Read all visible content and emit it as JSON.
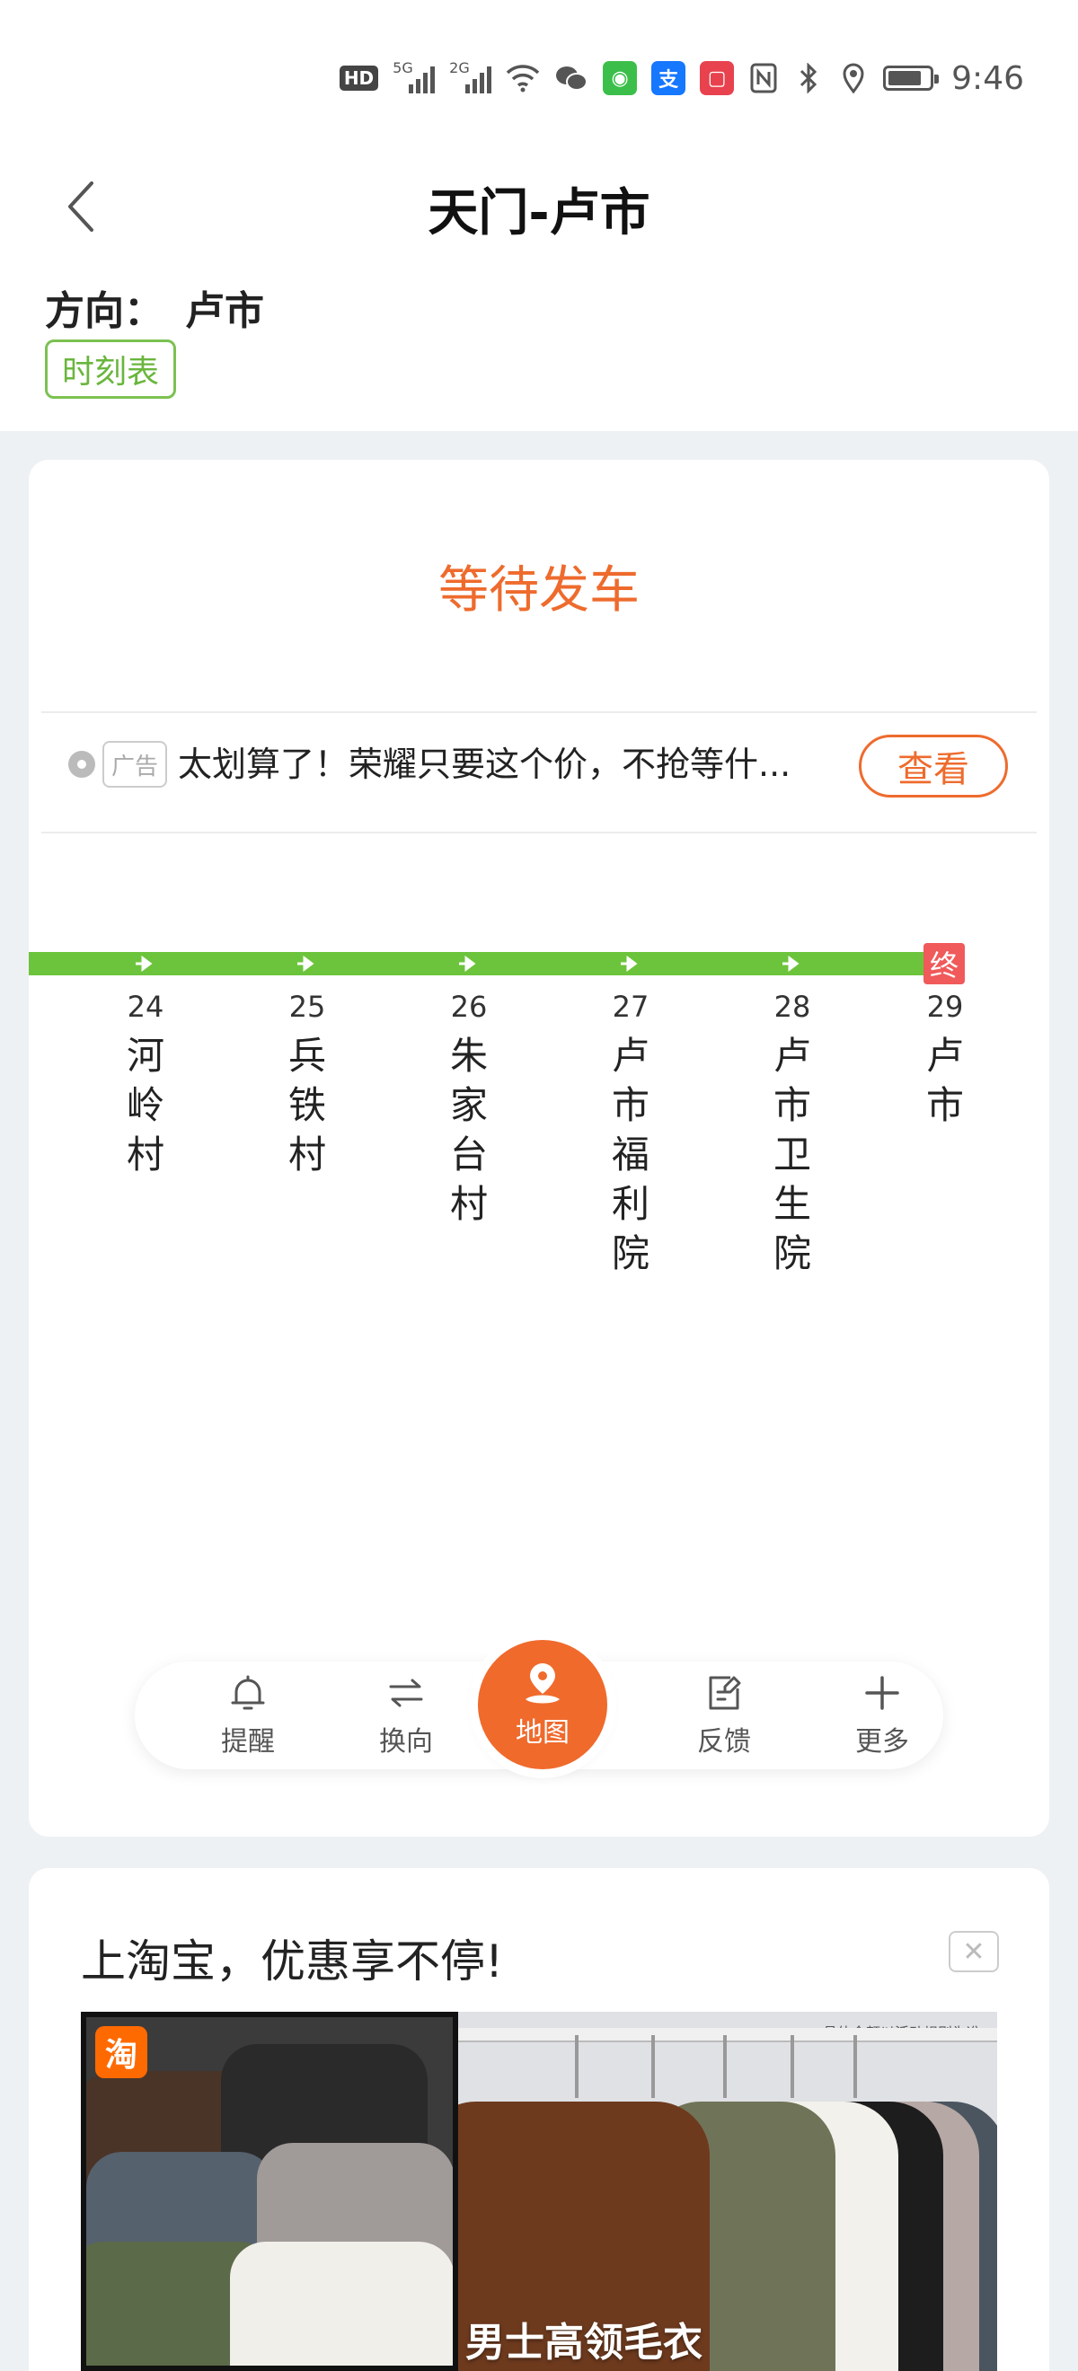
{
  "status_bar": {
    "hd": "HD",
    "signal1": "5G",
    "signal2": "2G",
    "time": "9:46",
    "icons": [
      "hd-icon",
      "signal-5g-icon",
      "signal-2g-icon",
      "wifi-icon",
      "wechat-icon",
      "app-icon-green",
      "alipay-icon",
      "app-icon-red",
      "nfc-icon",
      "bluetooth-icon",
      "location-icon",
      "battery-icon"
    ]
  },
  "header": {
    "title": "天门-卢市",
    "direction_label": "方向：",
    "direction_value": "卢市",
    "schedule_label": "时刻表"
  },
  "card": {
    "status": "等待发车",
    "ad": {
      "badge": "广告",
      "text": "太划算了！荣耀只要这个价，不抢等什...",
      "button": "查看"
    },
    "stops": [
      {
        "num": "24",
        "name": "河岭村"
      },
      {
        "num": "25",
        "name": "兵铁村"
      },
      {
        "num": "26",
        "name": "朱家台村"
      },
      {
        "num": "27",
        "name": "卢市福利院"
      },
      {
        "num": "28",
        "name": "卢市卫生院"
      },
      {
        "num": "29",
        "name": "卢市"
      }
    ],
    "terminal_label": "终",
    "toolbar": {
      "remind": "提醒",
      "switch": "换向",
      "map": "地图",
      "feedback": "反馈",
      "more": "更多"
    }
  },
  "promo": {
    "title": "上淘宝，优惠享不停!",
    "logo_text": "淘",
    "rule_note": "具体金额以活动规则为准",
    "caption": "男士高领毛衣"
  },
  "colors": {
    "accent": "#ee6b2d",
    "route_green": "#6cc43c",
    "schedule_green": "#7cc152",
    "terminal_red": "#f05a5a"
  }
}
